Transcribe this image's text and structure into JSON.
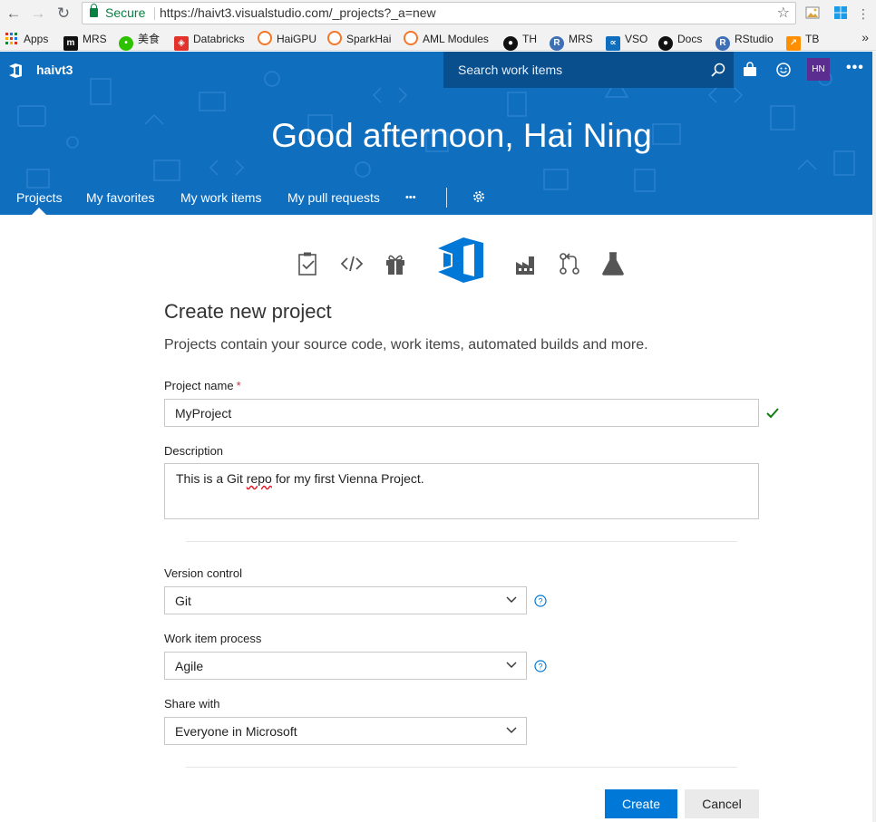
{
  "browser": {
    "secure_label": "Secure",
    "url": "https://haivt3.visualstudio.com/_projects?_a=new",
    "bookmarks": [
      {
        "label": "Apps",
        "icon": "apps-grid-icon"
      },
      {
        "label": "MRS",
        "icon": "m-icon"
      },
      {
        "label": "美食",
        "icon": "wechat-icon"
      },
      {
        "label": "Databricks",
        "icon": "databricks-icon"
      },
      {
        "label": "HaiGPU",
        "icon": "jupyter-icon"
      },
      {
        "label": "SparkHai",
        "icon": "jupyter-icon"
      },
      {
        "label": "AML Modules",
        "icon": "jupyter-icon"
      },
      {
        "label": "TH",
        "icon": "github-icon"
      },
      {
        "label": "MRS",
        "icon": "r-icon"
      },
      {
        "label": "VSO",
        "icon": "vso-icon"
      },
      {
        "label": "Docs",
        "icon": "github-icon"
      },
      {
        "label": "RStudio",
        "icon": "r-icon"
      },
      {
        "label": "TB",
        "icon": "tensorboard-icon"
      }
    ],
    "more": "»"
  },
  "header": {
    "account": "haivt3",
    "search_placeholder": "Search work items",
    "avatar_initials": "HN",
    "greeting": "Good afternoon, Hai Ning",
    "tabs": [
      "Projects",
      "My favorites",
      "My work items",
      "My pull requests"
    ],
    "more": "•••",
    "colors": {
      "hero": "#106ebe",
      "search": "#0a4f8d",
      "avatar": "#5c2d91"
    }
  },
  "form": {
    "title": "Create new project",
    "subtitle": "Projects contain your source code, work items, automated builds and more.",
    "project_name_label": "Project name",
    "required_mark": "*",
    "project_name_value": "MyProject",
    "description_label": "Description",
    "description_before": "This is a Git ",
    "description_misspelled": "repo",
    "description_after": " for my first Vienna Project.",
    "version_control_label": "Version control",
    "version_control_value": "Git",
    "work_item_process_label": "Work item process",
    "work_item_process_value": "Agile",
    "share_with_label": "Share with",
    "share_with_value": "Everyone in Microsoft",
    "create_label": "Create",
    "cancel_label": "Cancel",
    "colors": {
      "primary": "#0078d7",
      "valid": "#107c10",
      "help": "#0078d7"
    }
  }
}
